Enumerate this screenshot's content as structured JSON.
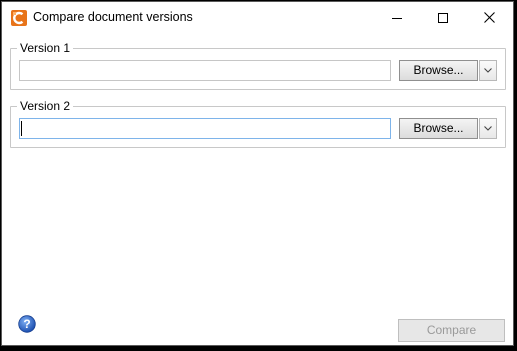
{
  "window": {
    "title": "Compare document versions",
    "controls": [
      "minimize-icon",
      "maximize-icon",
      "close-icon"
    ]
  },
  "versions": [
    {
      "legend": "Version 1",
      "path_value": "",
      "browse_label": "Browse...",
      "focused": false
    },
    {
      "legend": "Version 2",
      "path_value": "",
      "browse_label": "Browse...",
      "focused": true
    }
  ],
  "footer": {
    "help_icon": "help-icon",
    "compare_label": "Compare",
    "compare_enabled": false
  },
  "colors": {
    "app_icon": "#e8741a",
    "help_icon": "#2a66c9",
    "focus_border": "#7eb4ea",
    "disabled_text": "#9a9a9a"
  }
}
